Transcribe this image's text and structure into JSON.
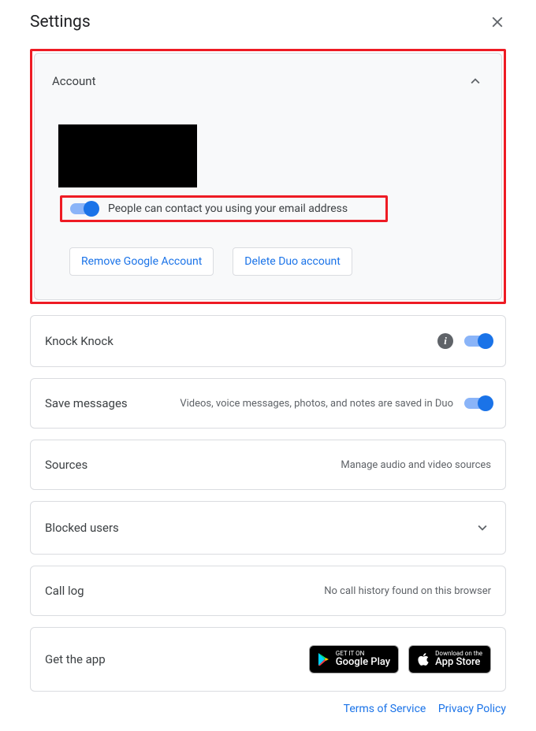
{
  "header": {
    "title": "Settings"
  },
  "account": {
    "title": "Account",
    "contact_toggle_label": "People can contact you using your email address",
    "contact_toggle_on": true,
    "remove_btn": "Remove Google Account",
    "delete_btn": "Delete Duo account"
  },
  "knock_knock": {
    "title": "Knock Knock",
    "toggle_on": true
  },
  "save_messages": {
    "title": "Save messages",
    "subtitle": "Videos, voice messages, photos, and notes are saved in Duo",
    "toggle_on": true
  },
  "sources": {
    "title": "Sources",
    "subtitle": "Manage audio and video sources"
  },
  "blocked_users": {
    "title": "Blocked users"
  },
  "call_log": {
    "title": "Call log",
    "subtitle": "No call history found on this browser"
  },
  "get_app": {
    "title": "Get the app",
    "google_play_small": "GET IT ON",
    "google_play_large": "Google Play",
    "app_store_small": "Download on the",
    "app_store_large": "App Store"
  },
  "footer": {
    "tos": "Terms of Service",
    "privacy": "Privacy Policy"
  }
}
